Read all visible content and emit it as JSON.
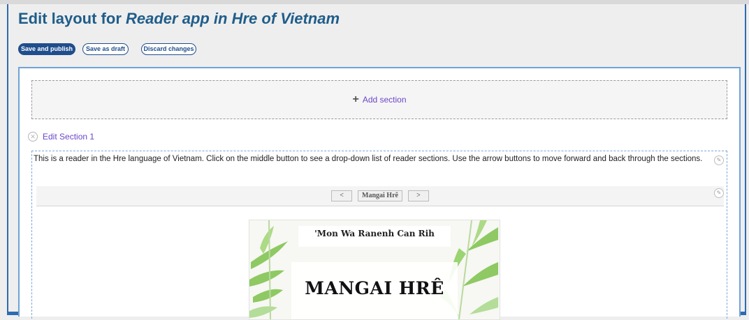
{
  "header": {
    "title_prefix": "Edit layout for ",
    "title_app": "Reader app in Hre of Vietnam"
  },
  "toolbar": {
    "save_publish_label": "Save and publish",
    "save_draft_label": "Save as draft",
    "discard_label": "Discard changes"
  },
  "editor": {
    "add_section_label": "Add section",
    "edit_section_label": "Edit Section 1",
    "description": "This is a reader in the Hre language of Vietnam. Click on the middle button to see a drop-down list of reader sections. Use the arrow buttons to move forward and back through the sections.",
    "nav": {
      "prev_label": "<",
      "section_label": "Mangai Hrê",
      "next_label": ">"
    },
    "cover": {
      "subtitle": "'Mon Wa Ranenh Can Rih",
      "title": "MANGAI HRÊ"
    }
  },
  "colors": {
    "accent": "#1f4e8c",
    "link": "#6b46c9",
    "title": "#1f5d8a",
    "frame": "#2e6bb0",
    "leaf": "#7cc24a"
  },
  "icons": [
    "plus-icon",
    "close-circle-icon",
    "pencil-icon",
    "bamboo-leaves-illustration"
  ]
}
